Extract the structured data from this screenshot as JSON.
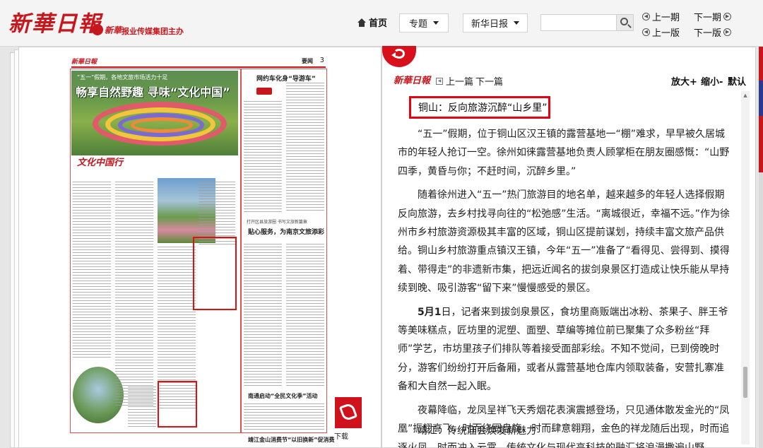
{
  "header": {
    "logo": "新華日報",
    "sub_logo_brand": "新華",
    "sub_logo_text": "报业传媒集团主办",
    "home_label": "首页",
    "topic_label": "专题",
    "paper_label": "新华日报",
    "search_placeholder": "",
    "prev_issue": "上一期",
    "next_issue": "下一期",
    "prev_edition": "上一版",
    "next_edition": "下一版"
  },
  "newspaper": {
    "logo": "新華日報",
    "section": "要闻",
    "page_number": "3",
    "hero_kicker": "“五一”假期，各地文旅市场活力十足",
    "hero_title": "畅享自然野趣 寻味“文化中国”",
    "column_brand": "文化中国行",
    "right_head": "网约车化身“导游车”",
    "mid_kicker": "打开区县旅游圈 书写文旅新篇章",
    "mid_head": "贴心服务，为南京文旅添彩",
    "low_head": "南通启动“全民文化季”活动",
    "bottom_head": "靖江金山消费节“以旧换新”促消费",
    "download_label": "下载"
  },
  "article": {
    "logo": "新華日報",
    "prev_article": "上一篇",
    "next_article": "下一篇",
    "zoom_in": "放大+",
    "zoom_out": "缩小-",
    "zoom_default": "默认",
    "title": "铜山：反向旅游沉醉“山乡里”",
    "paragraphs": [
      "“五一”假期，位于铜山区汉王镇的露营基地一“棚”难求，早早被久居城市的年轻人抢订一空。徐州如徕露营基地负责人顾掌柜在朋友圈感慨：“山野四季，黄昏与你；不赶时间，沉醉乡里。”",
      "随着徐州进入“五一”热门旅游目的地名单，越来越多的年轻人选择假期反向旅游，去乡村找寻向往的“松弛感”生活。“离城很近，幸福不远。”作为徐州市乡村旅游资源极其丰富的区域，铜山区提前谋划，持续丰富文旅产品供给。铜山乡村旅游重点镇汉王镇，今年“五一”准备了“看得见、尝得到、摸得着、带得走”的非遗新市集，把远近闻名的拔剑泉景区打造成让快乐能从早持续到晚、吸引游客“留下来”慢慢感受的景区。",
      "日，记者来到拔剑泉景区，食坊里商贩端出冰粉、茶果子、胖王爷等美味糕点，匠坊里的泥塑、面塑、草编等摊位前已聚集了众多粉丝“拜师”学艺，市坊里孩子们排队等着接受面部彩绘。不知不觉间，已到傍晚时分，游客们纷纷打开后备厢，或者从露营基地仓库内领取装备，安营扎寨准备和大自然一起入眠。",
      "夜幕降临，龙凤呈祥飞天秀烟花表演震撼登场，只见通体散发金光的“凤凰”振翅高飞，时而绕圈盘旋，时而肆意翱翔，金色的祥龙随后出现，时而追逐火凤，时而冲入云霄，传统文化与现代高科技的融汇将浪漫撒遍山野。"
    ],
    "date_bold": "5月1",
    "subhead": "靖江：传统庙会焕发新魅力"
  },
  "colors": {
    "brand_red": "#c8161d",
    "highlight_red": "#e60012",
    "edge_blue": "#2a3b8f"
  },
  "icons": [
    "home-icon",
    "caret-down-icon",
    "search-icon",
    "circle-arrow-icon",
    "back-arrow-icon",
    "pdf-icon",
    "square-arrow-icon"
  ]
}
